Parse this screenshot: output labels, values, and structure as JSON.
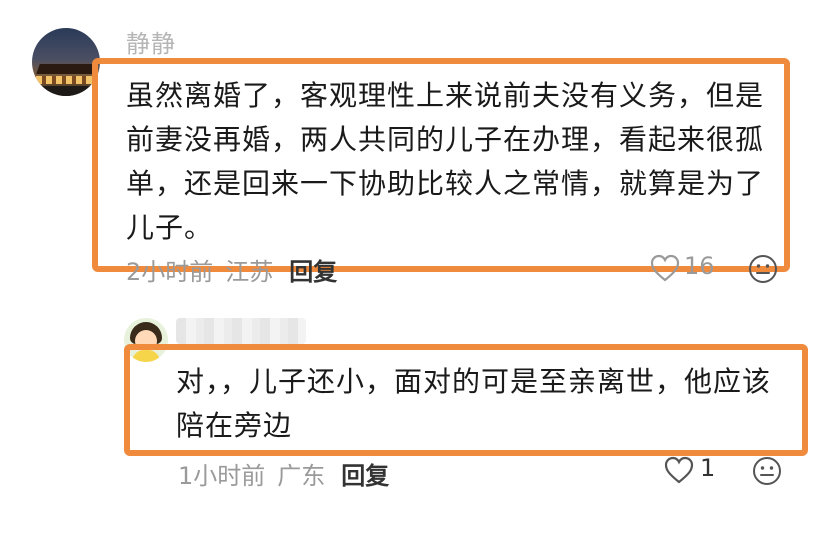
{
  "comments": [
    {
      "username": "静静",
      "text": "虽然离婚了，客观理性上来说前夫没有义务，但是前妻没再婚，两人共同的儿子在办理，看起来很孤单，还是回来一下协助比较人之常情，就算是为了儿子。",
      "time": "2小时前",
      "location": "江苏",
      "reply_label": "回复",
      "likes": "16",
      "avatar_icon": "avatar-night-scene-icon"
    },
    {
      "username": "",
      "text": "对，，儿子还小，面对的可是至亲离世，他应该陪在旁边",
      "time": "1小时前",
      "location": "广东",
      "reply_label": "回复",
      "likes": "1",
      "avatar_icon": "avatar-cartoon-girl-icon"
    }
  ],
  "colors": {
    "highlight_border": "#f08a3c",
    "meta_text": "#9a9a9a"
  }
}
